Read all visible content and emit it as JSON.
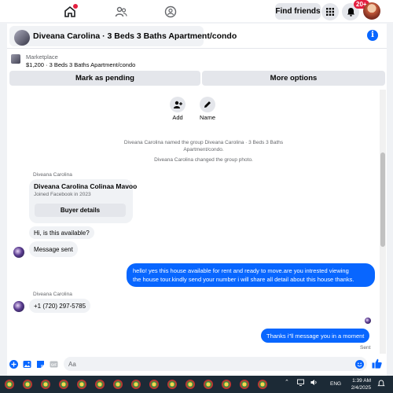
{
  "topnav": {
    "find_friends": "Find friends",
    "notification_badge": "20+"
  },
  "header": {
    "title": "Diveana Carolina · 3 Beds 3 Baths Apartment/condo"
  },
  "marketplace": {
    "label": "Marketplace",
    "listing": "$1,200 · 3 Beds 3 Baths Apartment/condo",
    "mark_pending": "Mark as pending",
    "more_options": "More options"
  },
  "actions": {
    "add": "Add",
    "name": "Name"
  },
  "system": {
    "named_group_line1": "Diveana Carolina named the group Diveana Carolina · 3 Beds 3 Baths",
    "named_group_line2": "Apartment/condo.",
    "changed_photo": "Diveana Carolina changed the group photo."
  },
  "messages": {
    "sender1": "Diveana Carolina",
    "card_name": "Diveana Carolina Colinaa Mavoo",
    "card_sub": "Joined Facebook in 2023",
    "card_button": "Buyer details",
    "msg_available": "Hi, is this available?",
    "msg_sent_text": "Message sent",
    "out1_line1": "hello! yes this house available for rent and ready to move.are you intrested viewing",
    "out1_line2": "the house tour.kindly send your number i will share all detail about this house thanks.",
    "sender2": "Diveana Carolina",
    "phone": "+1 (720) 297-5785",
    "out2": "Thanks i\"ll message you in a moment",
    "sent_status": "Sent"
  },
  "composer": {
    "placeholder": "Aa"
  },
  "taskbar": {
    "lang": "ENG",
    "time": "1:39 AM",
    "date": "2/4/2025"
  },
  "colors": {
    "brand_blue": "#0866ff",
    "bubble_grey": "#f0f2f5",
    "badge_red": "#e41e3f"
  }
}
